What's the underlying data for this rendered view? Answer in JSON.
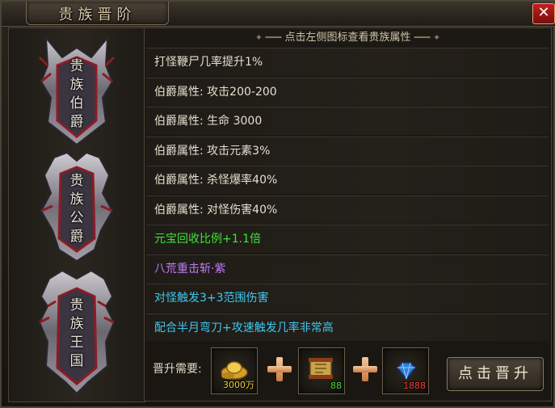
{
  "window": {
    "title": "贵族晋阶",
    "close_label": "✕"
  },
  "badges": [
    {
      "label": "贵族伯爵",
      "chars": [
        "贵",
        "族",
        "伯",
        "爵"
      ]
    },
    {
      "label": "贵族公爵",
      "chars": [
        "贵",
        "族",
        "公",
        "爵"
      ]
    },
    {
      "label": "贵族王国",
      "chars": [
        "贵",
        "族",
        "王",
        "国"
      ]
    }
  ],
  "hint": {
    "text": "点击左侧图标查看贵族属性"
  },
  "attributes": [
    {
      "text": "打怪鞭尸几率提升1%",
      "color": "#e6dfcf"
    },
    {
      "text": "伯爵属性:  攻击200-200",
      "color": "#e6dfcf"
    },
    {
      "text": "伯爵属性:  生命 3000",
      "color": "#e6dfcf"
    },
    {
      "text": "伯爵属性:  攻击元素3%",
      "color": "#e6dfcf"
    },
    {
      "text": "伯爵属性:  杀怪爆率40%",
      "color": "#e6dfcf"
    },
    {
      "text": "伯爵属性:  对怪伤害40%",
      "color": "#e6dfcf"
    },
    {
      "text": "元宝回收比例+1.1倍",
      "color": "#3ee43a"
    },
    {
      "text": "八荒重击斩·紫",
      "color": "#c17cf2"
    },
    {
      "text": "对怪触发3+3范围伤害",
      "color": "#3fc8f0"
    },
    {
      "text": "配合半月弯刀+攻速触发几率非常高",
      "color": "#3fc8f0"
    }
  ],
  "requirements": {
    "label": "晋升需要:",
    "items": [
      {
        "name": "gold-ingot-icon",
        "count": "3000万",
        "count_color": "#f2d33a"
      },
      {
        "name": "scroll-icon",
        "count": "88",
        "count_color": "#42e03c"
      },
      {
        "name": "blue-gem-icon",
        "count": "1888",
        "count_color": "#ff3a3a"
      }
    ]
  },
  "promote_button": {
    "label": "点击晋升"
  }
}
